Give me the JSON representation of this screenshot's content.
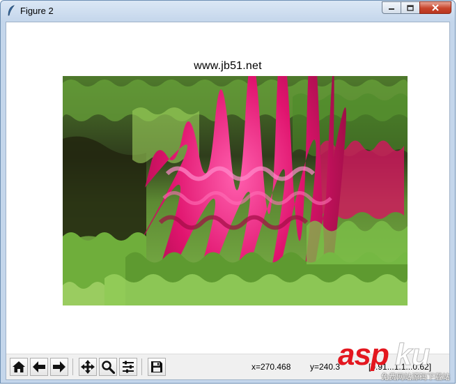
{
  "window": {
    "title": "Figure 2",
    "minimize_label": "minimize",
    "maximize_label": "maximize",
    "close_label": "close"
  },
  "figure": {
    "title": "www.jb51.net"
  },
  "toolbar": {
    "buttons": [
      {
        "name": "home-icon"
      },
      {
        "name": "back-arrow-icon"
      },
      {
        "name": "forward-arrow-icon"
      },
      {
        "name": "pan-icon"
      },
      {
        "name": "zoom-icon"
      },
      {
        "name": "configure-subplots-icon"
      },
      {
        "name": "save-icon"
      }
    ],
    "x_readout": "x=270.468",
    "y_readout": "y=240.3",
    "pixel_readout": "[0.91...1.1...0.62]"
  },
  "watermark": {
    "brand_red": "asp",
    "brand_white": "ku",
    "subtitle": "免费网站源码下载站"
  },
  "colors": {
    "accent_red": "#e3171f",
    "titlebar": "#c4d6eb",
    "toolbar_bg": "#f0f0f0"
  }
}
